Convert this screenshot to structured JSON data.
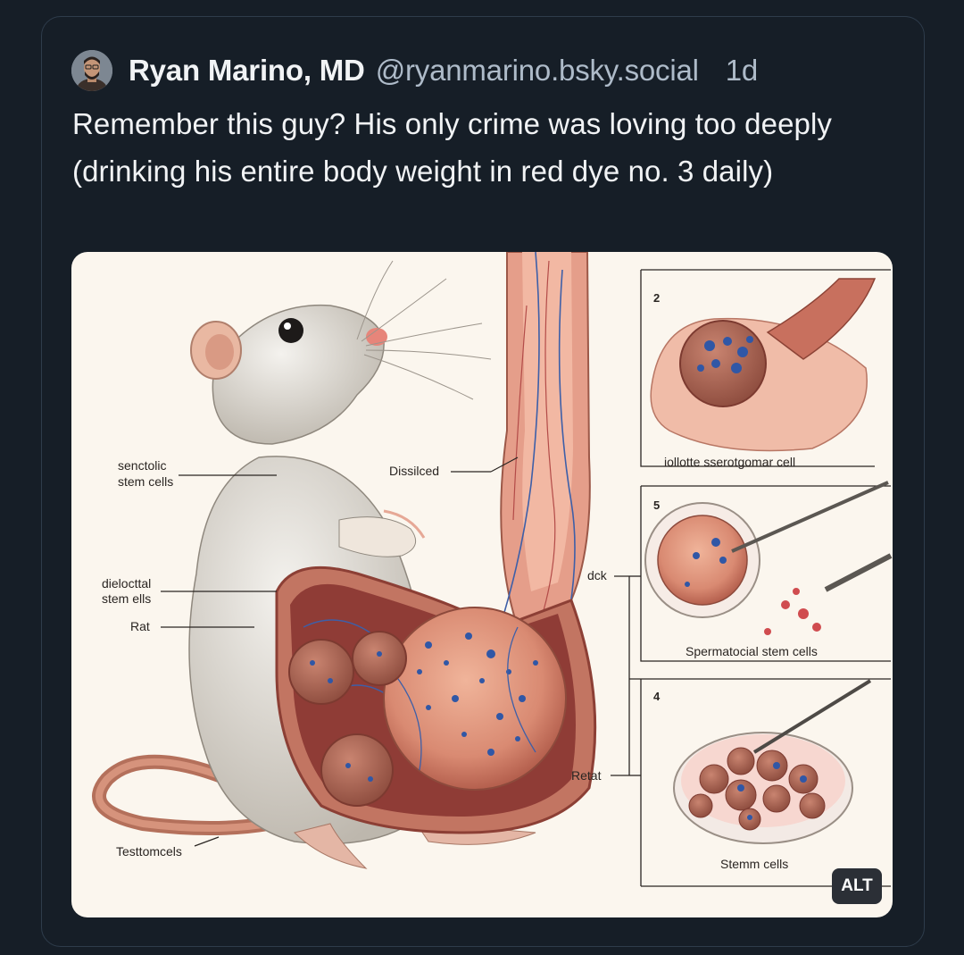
{
  "post": {
    "author_name": "Ryan Marino, MD",
    "handle": "@ryanmarino.bsky.social",
    "time": "1d",
    "text": "Remember this guy? His only crime was loving too deeply (drinking his entire body weight in red dye no. 3 daily)",
    "alt_badge": "ALT"
  },
  "figure_labels": {
    "senctolic_1": "senctolic",
    "senctolic_2": "stem cells",
    "dissilced": "Dissilced",
    "dielocttal_1": "dielocttal",
    "dielocttal_2": "stem ells",
    "rat": "Rat",
    "testtomcels": "Testtomcels",
    "dck": "dck",
    "retat": "Retat",
    "panel2_num": "2",
    "panel2_caption": "iollotte sserotgomar cell",
    "panel5_num": "5",
    "panel5_caption": "Spermatocial stem cells",
    "panel4_num": "4",
    "panel4_caption": "Stemm cells"
  },
  "colors": {
    "background": "#161e27",
    "card_border": "#2e3c4b",
    "primary_text": "#f1f3f5",
    "secondary_text": "#aebbc9"
  }
}
